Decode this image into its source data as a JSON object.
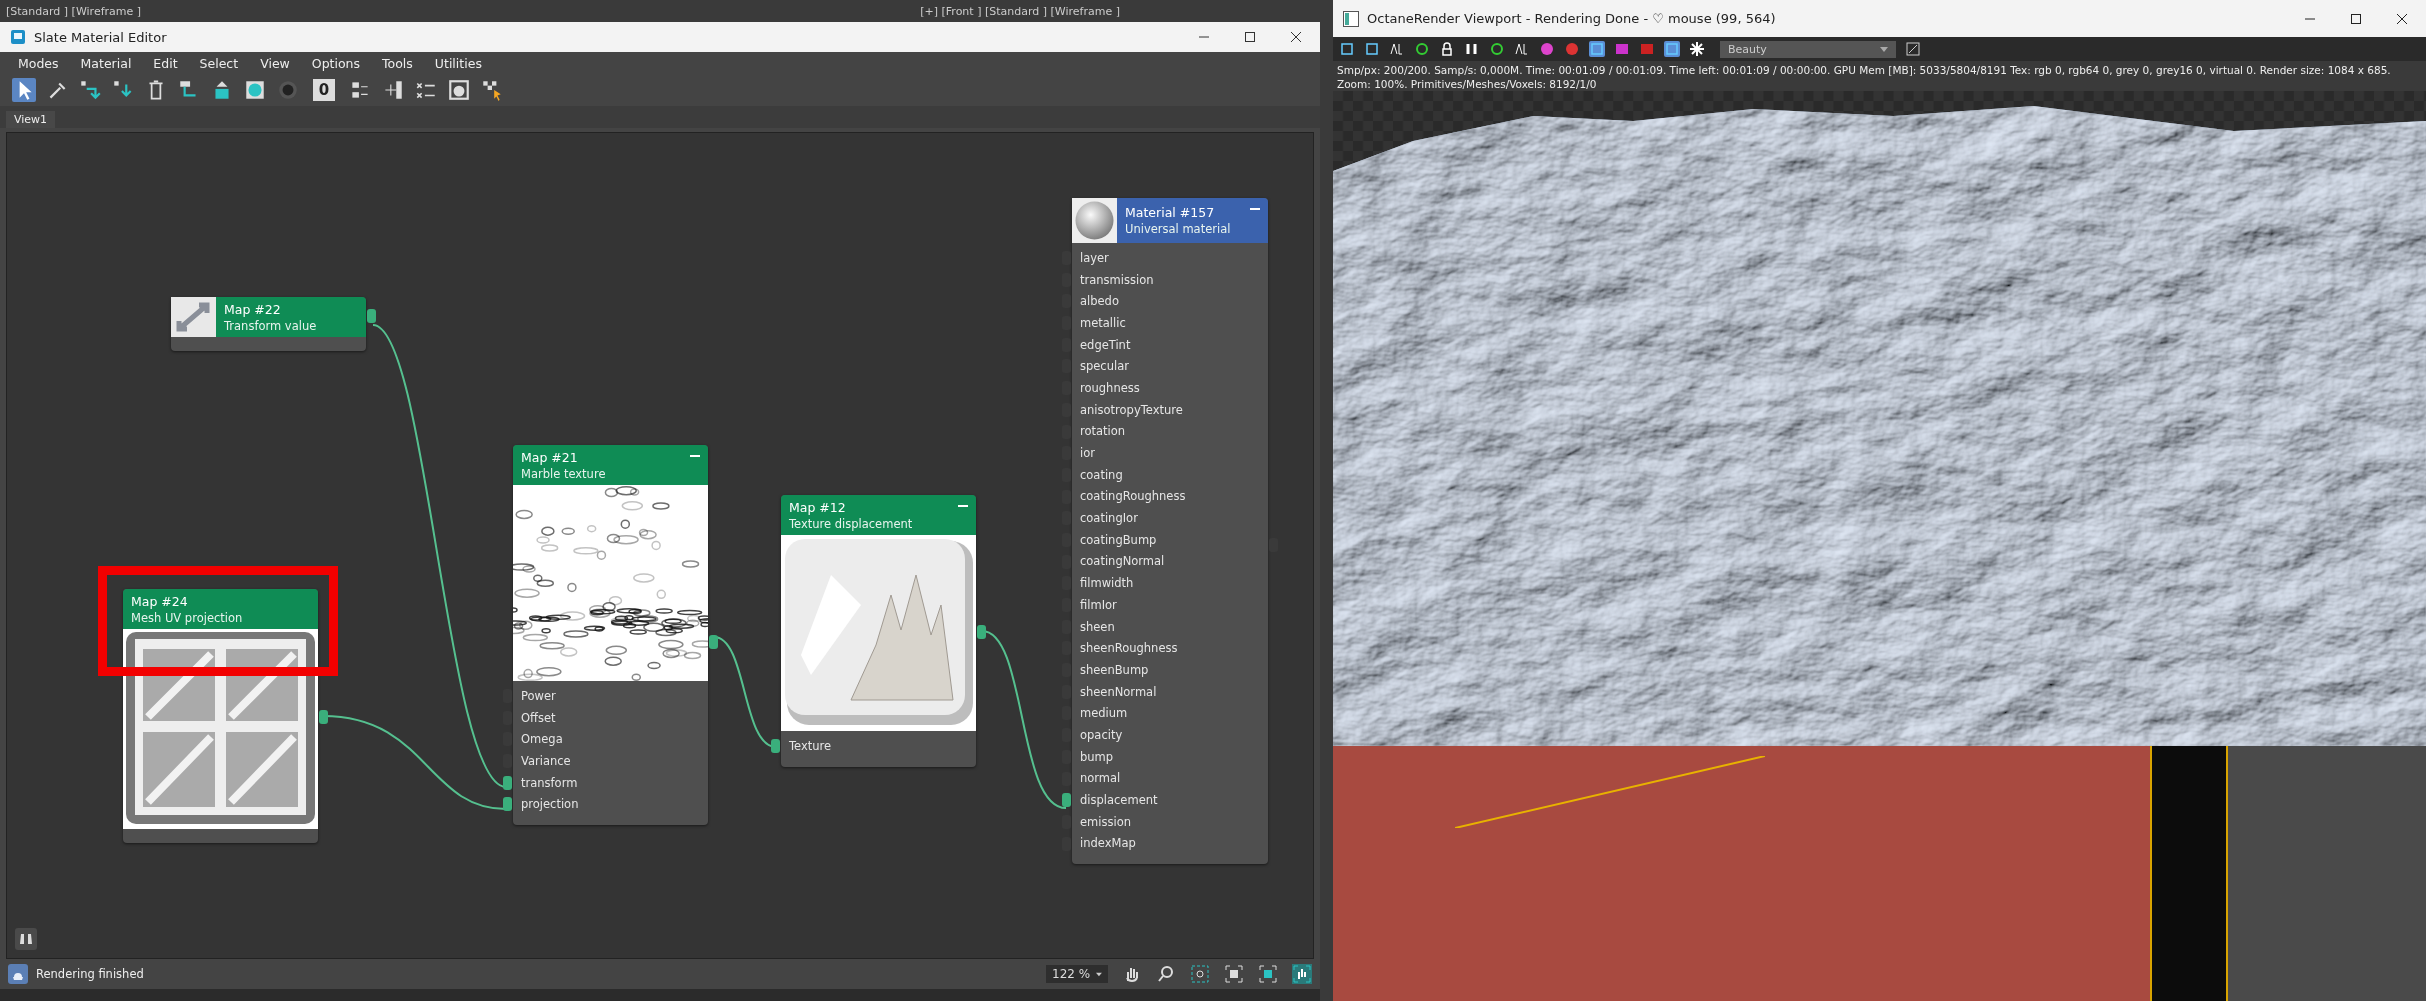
{
  "background_viewport": {
    "left_label": "[Standard ] [Wireframe ]",
    "right_label": "[+] [Front ] [Standard ] [Wireframe ]"
  },
  "slate_editor": {
    "title": "Slate Material Editor",
    "menu": [
      "Modes",
      "Material",
      "Edit",
      "Select",
      "View",
      "Options",
      "Tools",
      "Utilities"
    ],
    "material_id_button": "0",
    "tabs": [
      {
        "label": "View1",
        "selected": true
      }
    ],
    "nodes": [
      {
        "title": "Map #22",
        "subtitle": "Transform value",
        "kind": "transform",
        "color": "#0f8c55",
        "collapsible": false,
        "output_connected": true
      },
      {
        "title": "Map #21",
        "subtitle": "Marble texture",
        "kind": "marble",
        "color": "#0f8c55",
        "collapsible": true,
        "output_connected": true,
        "inputs": [
          {
            "name": "Power",
            "connected": false
          },
          {
            "name": "Offset",
            "connected": false
          },
          {
            "name": "Omega",
            "connected": false
          },
          {
            "name": "Variance",
            "connected": false
          },
          {
            "name": "transform",
            "connected": true
          },
          {
            "name": "projection",
            "connected": true
          }
        ]
      },
      {
        "title": "Map #12",
        "subtitle": "Texture displacement",
        "kind": "displacement",
        "color": "#0f8c55",
        "collapsible": true,
        "output_connected": true,
        "inputs": [
          {
            "name": "Texture",
            "connected": true
          }
        ]
      },
      {
        "title": "Map #24",
        "subtitle": "Mesh UV projection",
        "kind": "uv",
        "color": "#0f8c55",
        "collapsible": false,
        "output_connected": true
      },
      {
        "title": "Material #157",
        "subtitle": "Universal material",
        "kind": "material",
        "color": "#3b62ad",
        "collapsible": true,
        "output_connected": false,
        "inputs": [
          {
            "name": "layer",
            "connected": false
          },
          {
            "name": "transmission",
            "connected": false
          },
          {
            "name": "albedo",
            "connected": false
          },
          {
            "name": "metallic",
            "connected": false
          },
          {
            "name": "edgeTint",
            "connected": false
          },
          {
            "name": "specular",
            "connected": false
          },
          {
            "name": "roughness",
            "connected": false
          },
          {
            "name": "anisotropyTexture",
            "connected": false
          },
          {
            "name": "rotation",
            "connected": false
          },
          {
            "name": "ior",
            "connected": false
          },
          {
            "name": "coating",
            "connected": false
          },
          {
            "name": "coatingRoughness",
            "connected": false
          },
          {
            "name": "coatingIor",
            "connected": false
          },
          {
            "name": "coatingBump",
            "connected": false
          },
          {
            "name": "coatingNormal",
            "connected": false
          },
          {
            "name": "filmwidth",
            "connected": false
          },
          {
            "name": "filmIor",
            "connected": false
          },
          {
            "name": "sheen",
            "connected": false
          },
          {
            "name": "sheenRoughness",
            "connected": false
          },
          {
            "name": "sheenBump",
            "connected": false
          },
          {
            "name": "sheenNormal",
            "connected": false
          },
          {
            "name": "medium",
            "connected": false
          },
          {
            "name": "opacity",
            "connected": false
          },
          {
            "name": "bump",
            "connected": false
          },
          {
            "name": "normal",
            "connected": false
          },
          {
            "name": "displacement",
            "connected": true
          },
          {
            "name": "emission",
            "connected": false
          },
          {
            "name": "indexMap",
            "connected": false
          }
        ]
      }
    ],
    "status": "Rendering finished",
    "zoom": "122 %"
  },
  "octane_viewport": {
    "title": "OctaneRender Viewport - Rendering Done - ♡ mouse (99, 564)",
    "render_pass": "Beauty",
    "stats": [
      "Smp/px: 200/200.   Samp/s: 0,000M.   Time: 00:01:09 / 00:01:09.   Time left: 00:01:09 / 00:00:00.   GPU Mem [MB]: 5033/5804/8191   Tex: rgb 0, rgb64 0, grey 0, grey16 0, virtual 0.   Render size: 1084 x 685.",
      "Zoom: 100%.   Primitives/Meshes/Voxels: 8192/1/0"
    ]
  }
}
